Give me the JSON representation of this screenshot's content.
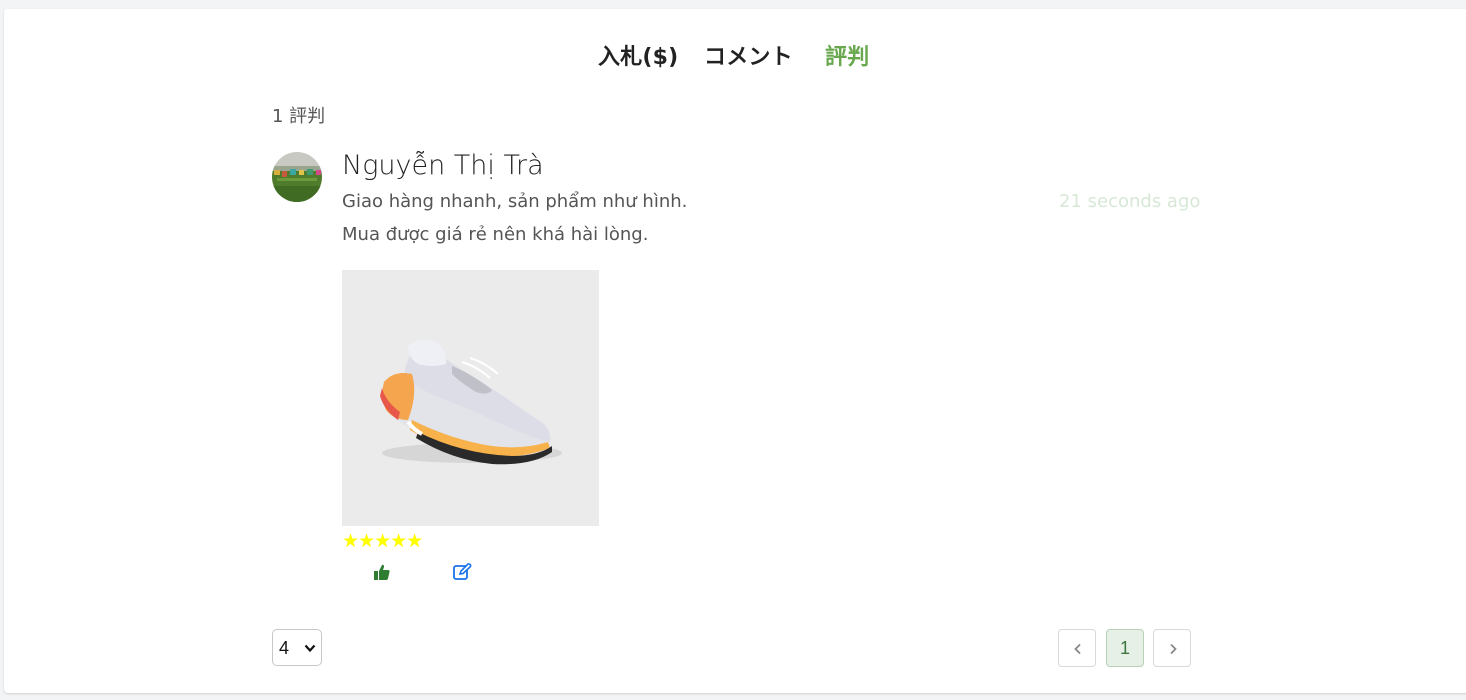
{
  "tabs": {
    "bid": "入札($)",
    "comment": "コメント",
    "review": "評判"
  },
  "reviews_count": "1 評判",
  "review": {
    "author": "Nguyễn Thị Trà",
    "text_line1": "Giao hàng nhanh, sản phẩm như hình.",
    "text_line2": "Mua được giá rẻ nên khá hài lòng.",
    "time_ago": "21 seconds ago",
    "rating": 5,
    "stars": "★★★★★"
  },
  "per_page": {
    "selected": "4"
  },
  "pagination": {
    "current_page": "1"
  },
  "colors": {
    "active_tab": "#6aa84f",
    "star": "#ffff00",
    "like_icon": "#2e7d32",
    "edit_icon": "#1a73e8",
    "time_ago": "#d7e8d7",
    "current_page_bg": "#e6f0e6"
  },
  "icons": {
    "like": "thumbs-up-icon",
    "edit": "edit-icon",
    "prev": "chevron-left-icon",
    "next": "chevron-right-icon",
    "select": "chevron-down-icon"
  }
}
